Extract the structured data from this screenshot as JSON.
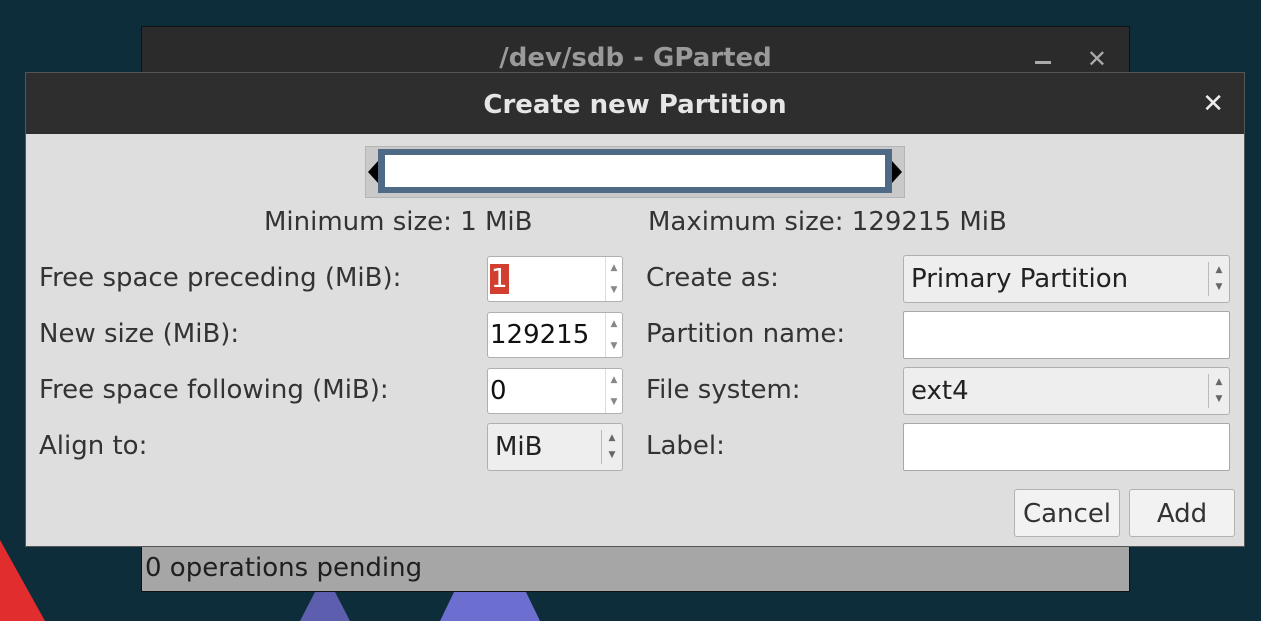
{
  "main_window": {
    "title": "/dev/sdb - GParted",
    "minimize_glyph": "_",
    "close_glyph": "✕",
    "status": "0 operations pending"
  },
  "dialog": {
    "title": "Create new Partition",
    "close_glyph": "✕",
    "min_size_text": "Minimum size: 1 MiB",
    "max_size_text": "Maximum size: 129215 MiB",
    "fields": {
      "free_preceding": {
        "label": "Free space preceding (MiB):",
        "value": "1"
      },
      "new_size": {
        "label": "New size (MiB):",
        "value": "129215"
      },
      "free_following": {
        "label": "Free space following (MiB):",
        "value": "0"
      },
      "align_to": {
        "label": "Align to:",
        "value": "MiB"
      },
      "create_as": {
        "label": "Create as:",
        "value": "Primary Partition"
      },
      "partition_name": {
        "label": "Partition name:",
        "value": ""
      },
      "file_system": {
        "label": "File system:",
        "value": "ext4"
      },
      "fs_label": {
        "label": "Label:",
        "value": ""
      }
    },
    "buttons": {
      "cancel": "Cancel",
      "add": "Add"
    },
    "glyphs": {
      "up": "▲",
      "down": "▼"
    },
    "colors": {
      "selection": "#d23f31",
      "resizer_frame": "#4f6a85"
    }
  }
}
